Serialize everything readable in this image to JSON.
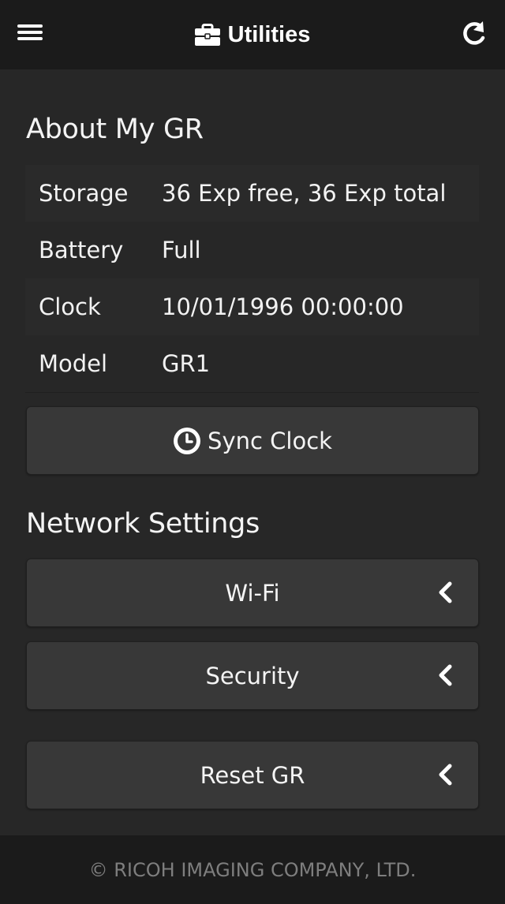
{
  "header": {
    "title": "Utilities",
    "menu_icon": "hamburger-menu-icon",
    "title_icon": "briefcase-icon",
    "refresh_icon": "refresh-icon"
  },
  "about": {
    "title": "About My GR",
    "rows": [
      {
        "label": "Storage",
        "value": "36 Exp free, 36 Exp total"
      },
      {
        "label": "Battery",
        "value": "Full"
      },
      {
        "label": "Clock",
        "value": "10/01/1996 00:00:00"
      },
      {
        "label": "Model",
        "value": "GR1"
      }
    ],
    "sync_button": "Sync Clock",
    "sync_icon": "clock-icon"
  },
  "network": {
    "title": "Network Settings",
    "wifi_button": "Wi-Fi",
    "security_button": "Security",
    "expand_icon": "chevron-left-icon"
  },
  "reset": {
    "button": "Reset GR"
  },
  "footer": {
    "text": "© RICOH IMAGING COMPANY, LTD."
  },
  "colors": {
    "background": "#272727",
    "bar": "#1b1b1b",
    "button": "#383838",
    "footer_text": "#7e7e7e"
  }
}
